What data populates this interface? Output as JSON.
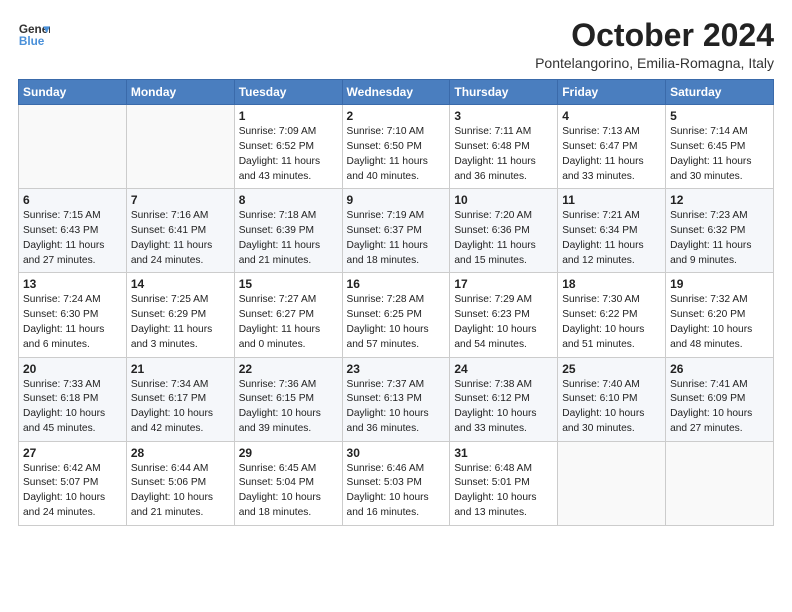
{
  "header": {
    "logo_line1": "General",
    "logo_line2": "Blue",
    "month_title": "October 2024",
    "location": "Pontelangorino, Emilia-Romagna, Italy"
  },
  "weekdays": [
    "Sunday",
    "Monday",
    "Tuesday",
    "Wednesday",
    "Thursday",
    "Friday",
    "Saturday"
  ],
  "weeks": [
    [
      {
        "day": "",
        "info": ""
      },
      {
        "day": "",
        "info": ""
      },
      {
        "day": "1",
        "info": "Sunrise: 7:09 AM\nSunset: 6:52 PM\nDaylight: 11 hours and 43 minutes."
      },
      {
        "day": "2",
        "info": "Sunrise: 7:10 AM\nSunset: 6:50 PM\nDaylight: 11 hours and 40 minutes."
      },
      {
        "day": "3",
        "info": "Sunrise: 7:11 AM\nSunset: 6:48 PM\nDaylight: 11 hours and 36 minutes."
      },
      {
        "day": "4",
        "info": "Sunrise: 7:13 AM\nSunset: 6:47 PM\nDaylight: 11 hours and 33 minutes."
      },
      {
        "day": "5",
        "info": "Sunrise: 7:14 AM\nSunset: 6:45 PM\nDaylight: 11 hours and 30 minutes."
      }
    ],
    [
      {
        "day": "6",
        "info": "Sunrise: 7:15 AM\nSunset: 6:43 PM\nDaylight: 11 hours and 27 minutes."
      },
      {
        "day": "7",
        "info": "Sunrise: 7:16 AM\nSunset: 6:41 PM\nDaylight: 11 hours and 24 minutes."
      },
      {
        "day": "8",
        "info": "Sunrise: 7:18 AM\nSunset: 6:39 PM\nDaylight: 11 hours and 21 minutes."
      },
      {
        "day": "9",
        "info": "Sunrise: 7:19 AM\nSunset: 6:37 PM\nDaylight: 11 hours and 18 minutes."
      },
      {
        "day": "10",
        "info": "Sunrise: 7:20 AM\nSunset: 6:36 PM\nDaylight: 11 hours and 15 minutes."
      },
      {
        "day": "11",
        "info": "Sunrise: 7:21 AM\nSunset: 6:34 PM\nDaylight: 11 hours and 12 minutes."
      },
      {
        "day": "12",
        "info": "Sunrise: 7:23 AM\nSunset: 6:32 PM\nDaylight: 11 hours and 9 minutes."
      }
    ],
    [
      {
        "day": "13",
        "info": "Sunrise: 7:24 AM\nSunset: 6:30 PM\nDaylight: 11 hours and 6 minutes."
      },
      {
        "day": "14",
        "info": "Sunrise: 7:25 AM\nSunset: 6:29 PM\nDaylight: 11 hours and 3 minutes."
      },
      {
        "day": "15",
        "info": "Sunrise: 7:27 AM\nSunset: 6:27 PM\nDaylight: 11 hours and 0 minutes."
      },
      {
        "day": "16",
        "info": "Sunrise: 7:28 AM\nSunset: 6:25 PM\nDaylight: 10 hours and 57 minutes."
      },
      {
        "day": "17",
        "info": "Sunrise: 7:29 AM\nSunset: 6:23 PM\nDaylight: 10 hours and 54 minutes."
      },
      {
        "day": "18",
        "info": "Sunrise: 7:30 AM\nSunset: 6:22 PM\nDaylight: 10 hours and 51 minutes."
      },
      {
        "day": "19",
        "info": "Sunrise: 7:32 AM\nSunset: 6:20 PM\nDaylight: 10 hours and 48 minutes."
      }
    ],
    [
      {
        "day": "20",
        "info": "Sunrise: 7:33 AM\nSunset: 6:18 PM\nDaylight: 10 hours and 45 minutes."
      },
      {
        "day": "21",
        "info": "Sunrise: 7:34 AM\nSunset: 6:17 PM\nDaylight: 10 hours and 42 minutes."
      },
      {
        "day": "22",
        "info": "Sunrise: 7:36 AM\nSunset: 6:15 PM\nDaylight: 10 hours and 39 minutes."
      },
      {
        "day": "23",
        "info": "Sunrise: 7:37 AM\nSunset: 6:13 PM\nDaylight: 10 hours and 36 minutes."
      },
      {
        "day": "24",
        "info": "Sunrise: 7:38 AM\nSunset: 6:12 PM\nDaylight: 10 hours and 33 minutes."
      },
      {
        "day": "25",
        "info": "Sunrise: 7:40 AM\nSunset: 6:10 PM\nDaylight: 10 hours and 30 minutes."
      },
      {
        "day": "26",
        "info": "Sunrise: 7:41 AM\nSunset: 6:09 PM\nDaylight: 10 hours and 27 minutes."
      }
    ],
    [
      {
        "day": "27",
        "info": "Sunrise: 6:42 AM\nSunset: 5:07 PM\nDaylight: 10 hours and 24 minutes."
      },
      {
        "day": "28",
        "info": "Sunrise: 6:44 AM\nSunset: 5:06 PM\nDaylight: 10 hours and 21 minutes."
      },
      {
        "day": "29",
        "info": "Sunrise: 6:45 AM\nSunset: 5:04 PM\nDaylight: 10 hours and 18 minutes."
      },
      {
        "day": "30",
        "info": "Sunrise: 6:46 AM\nSunset: 5:03 PM\nDaylight: 10 hours and 16 minutes."
      },
      {
        "day": "31",
        "info": "Sunrise: 6:48 AM\nSunset: 5:01 PM\nDaylight: 10 hours and 13 minutes."
      },
      {
        "day": "",
        "info": ""
      },
      {
        "day": "",
        "info": ""
      }
    ]
  ]
}
